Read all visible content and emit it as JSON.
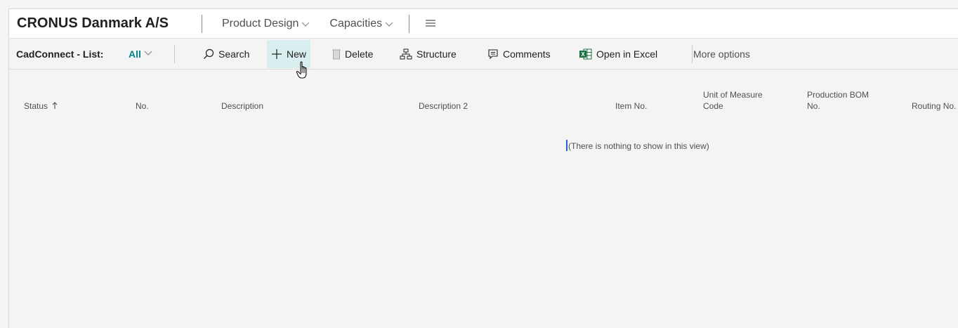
{
  "navbar": {
    "company": "CRONUS Danmark A/S",
    "menus": [
      {
        "label": "Product Design"
      },
      {
        "label": "Capacities"
      }
    ]
  },
  "actionbar": {
    "caption": "CadConnect - List:",
    "view_filter": "All",
    "actions": {
      "search": "Search",
      "new": "New",
      "delete": "Delete",
      "structure": "Structure",
      "comments": "Comments",
      "open_in_excel": "Open in Excel",
      "more_options": "More options"
    }
  },
  "list": {
    "columns": {
      "status": "Status",
      "no": "No.",
      "description": "Description",
      "description2": "Description 2",
      "item_no": "Item No.",
      "uom_line1": "Unit of Measure",
      "uom_line2": "Code",
      "bom_line1": "Production BOM",
      "bom_line2": "No.",
      "routing": "Routing No."
    },
    "empty_message": "(There is nothing to show in this view)"
  },
  "colors": {
    "accent": "#008489",
    "hover": "#d9eeee",
    "excel_green": "#1d6f42"
  },
  "icons": [
    "search-icon",
    "plus-icon",
    "delete-icon",
    "structure-icon",
    "comments-icon",
    "excel-icon",
    "hamburger-icon",
    "chevron-down-icon",
    "sort-up-icon",
    "hand-cursor-icon"
  ]
}
